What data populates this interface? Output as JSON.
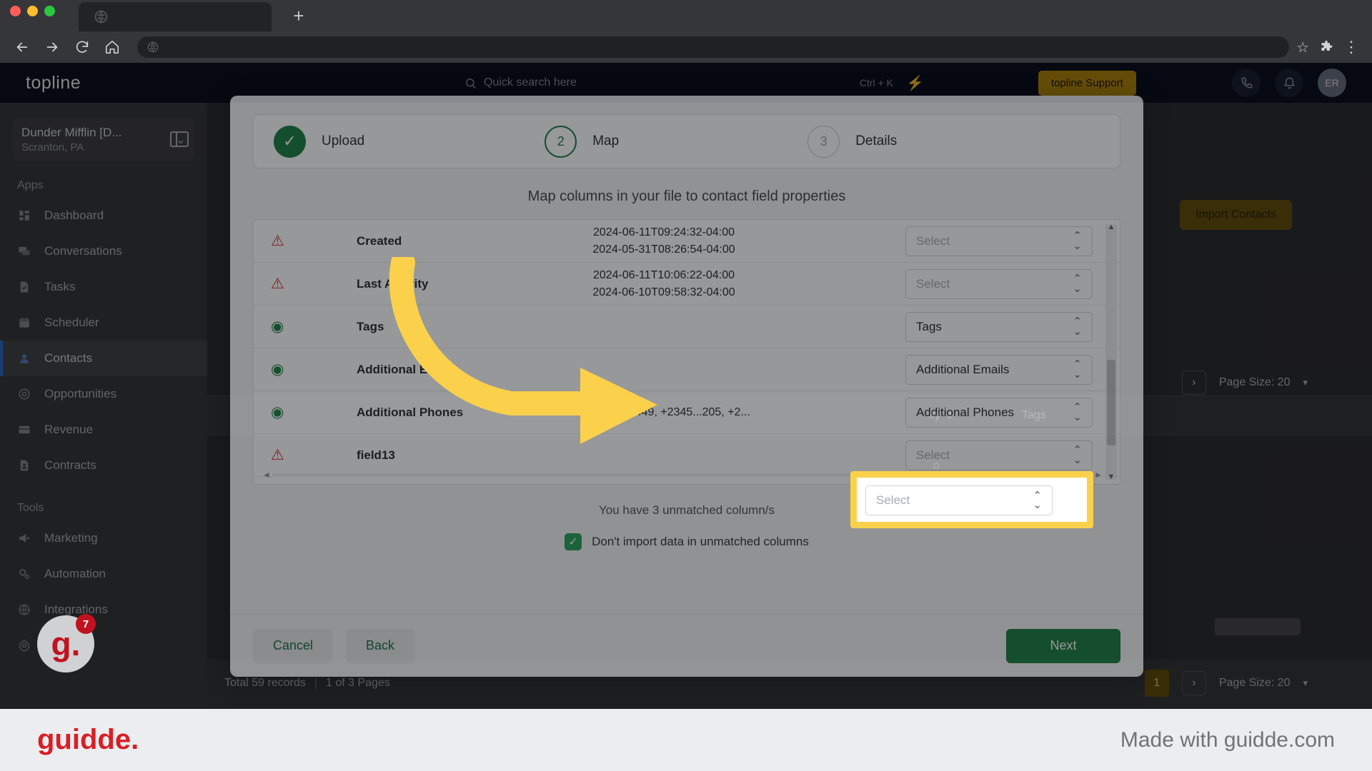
{
  "browser": {
    "tab_favicon": "globe-icon",
    "new_tab": "+",
    "back": "←",
    "forward": "→",
    "reload": "⟳",
    "home": "⌂",
    "star": "☆",
    "extensions": "puzzle-icon",
    "menu": "⋮",
    "address_value": ""
  },
  "app_header": {
    "logo": "topline",
    "search_placeholder": "Quick search here",
    "search_shortcut": "Ctrl + K",
    "bolt_icon": "lightning-icon",
    "support_button": "topline Support",
    "phone_icon": "phone-icon",
    "bell_icon": "bell-icon",
    "avatar_initials": "ER"
  },
  "sidebar": {
    "org_name": "Dunder Mifflin [D...",
    "org_location": "Scranton, PA",
    "sections": [
      {
        "label": "Apps",
        "items": [
          {
            "label": "Dashboard",
            "icon": "dashboard-icon",
            "active": false
          },
          {
            "label": "Conversations",
            "icon": "chat-icon",
            "active": false
          },
          {
            "label": "Tasks",
            "icon": "task-icon",
            "active": false
          },
          {
            "label": "Scheduler",
            "icon": "calendar-icon",
            "active": false
          },
          {
            "label": "Contacts",
            "icon": "person-icon",
            "active": true
          },
          {
            "label": "Opportunities",
            "icon": "target-icon",
            "active": false
          },
          {
            "label": "Revenue",
            "icon": "card-icon",
            "active": false
          },
          {
            "label": "Contracts",
            "icon": "document-icon",
            "active": false
          }
        ]
      },
      {
        "label": "Tools",
        "items": [
          {
            "label": "Marketing",
            "icon": "megaphone-icon",
            "active": false
          },
          {
            "label": "Automation",
            "icon": "gear-cog-icon",
            "active": false
          },
          {
            "label": "Integrations",
            "icon": "globe-icon",
            "active": false
          },
          {
            "label": "Settings",
            "icon": "settings-icon",
            "active": false
          }
        ]
      }
    ]
  },
  "main": {
    "import_contacts_button": "Import Contacts",
    "page_size_label": "Page Size: 20",
    "next_page_arrow": "›",
    "columns": [
      "ity",
      "Tags"
    ],
    "status_records": "Total 59 records",
    "status_separator": "|",
    "status_pages": "1 of 3 Pages",
    "current_page": "1"
  },
  "modal": {
    "steps": [
      {
        "number": "✓",
        "label": "Upload",
        "state": "done"
      },
      {
        "number": "2",
        "label": "Map",
        "state": "current"
      },
      {
        "number": "3",
        "label": "Details",
        "state": "todo"
      }
    ],
    "subtitle": "Map columns in your file to contact field properties",
    "rows": [
      {
        "status": "warn",
        "column": "Created",
        "sample": "2024-06-11T09:24:32-04:00\n2024-05-31T08:26:54-04:00",
        "select_value": "",
        "select_placeholder": "Select"
      },
      {
        "status": "warn",
        "column": "Last Activity",
        "sample": "2024-06-11T10:06:22-04:00\n2024-06-10T09:58:32-04:00",
        "select_value": "",
        "select_placeholder": "Select"
      },
      {
        "status": "ok",
        "column": "Tags",
        "sample": "",
        "select_value": "Tags",
        "select_placeholder": ""
      },
      {
        "status": "ok",
        "column": "Additional Emails",
        "sample": "",
        "select_value": "Additional Emails",
        "select_placeholder": ""
      },
      {
        "status": "ok",
        "column": "Additional Phones",
        "sample": "+19192224449, +2345...205, +2...",
        "select_value": "Additional Phones",
        "select_placeholder": ""
      },
      {
        "status": "warn",
        "column": "field13",
        "sample": "",
        "select_value": "",
        "select_placeholder": "Select"
      }
    ],
    "unmatched_message": "You have 3 unmatched column/s",
    "checkbox_label": "Don't import data in unmatched columns",
    "checkbox_checked": true,
    "cancel_button": "Cancel",
    "back_button": "Back",
    "next_button": "Next"
  },
  "annotation": {
    "highlight_select_placeholder": "Select",
    "badge_letter": "g.",
    "badge_count": "7",
    "guidde_logo": "guidde.",
    "made_with": "Made with guidde.com",
    "highlight_color": "#fbd14b"
  }
}
